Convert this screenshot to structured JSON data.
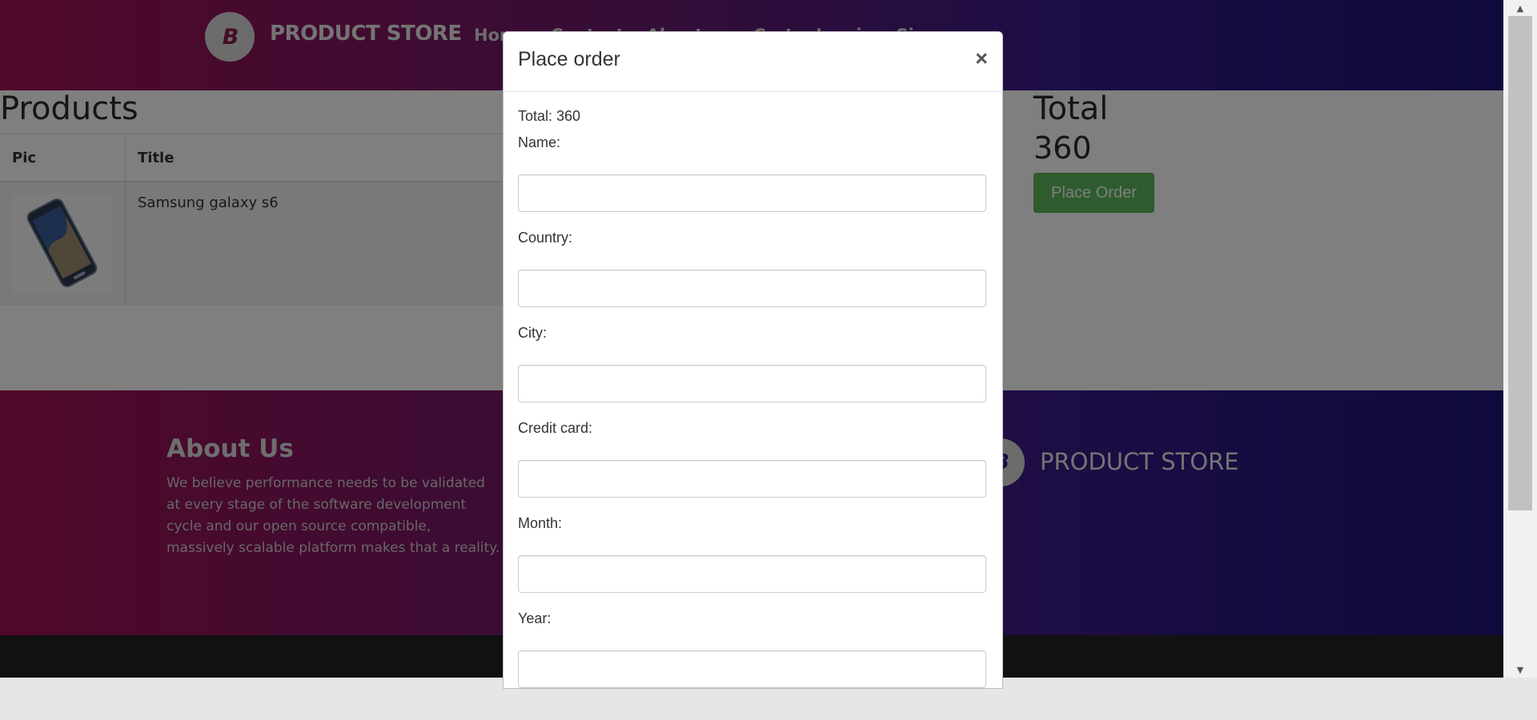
{
  "header": {
    "logo_letter": "B",
    "brand": "PRODUCT STORE",
    "nav": [
      "Home",
      "Contact",
      "About us",
      "Cart",
      "Log in",
      "Sign up"
    ]
  },
  "products": {
    "title": "Products",
    "columns": [
      "Pic",
      "Title"
    ],
    "rows": [
      {
        "title": "Samsung galaxy s6"
      }
    ]
  },
  "totals": {
    "heading": "Total",
    "value": "360",
    "place_order_label": "Place Order"
  },
  "footer": {
    "about_title": "About Us",
    "about_text": "We believe performance needs to be validated at every stage of the software development cycle and our open source compatible, massively scalable platform makes that a reality.",
    "logo_letter": "B",
    "brand": "PRODUCT STORE"
  },
  "modal": {
    "title": "Place order",
    "close": "×",
    "total_line": "Total: 360",
    "fields": [
      {
        "label": "Name:",
        "value": ""
      },
      {
        "label": "Country:",
        "value": ""
      },
      {
        "label": "City:",
        "value": ""
      },
      {
        "label": "Credit card:",
        "value": ""
      },
      {
        "label": "Month:",
        "value": ""
      },
      {
        "label": "Year:",
        "value": ""
      }
    ]
  },
  "colors": {
    "brand_gradient_start": "#a11152",
    "brand_gradient_end": "#1d1476",
    "success": "#5cb85c"
  }
}
